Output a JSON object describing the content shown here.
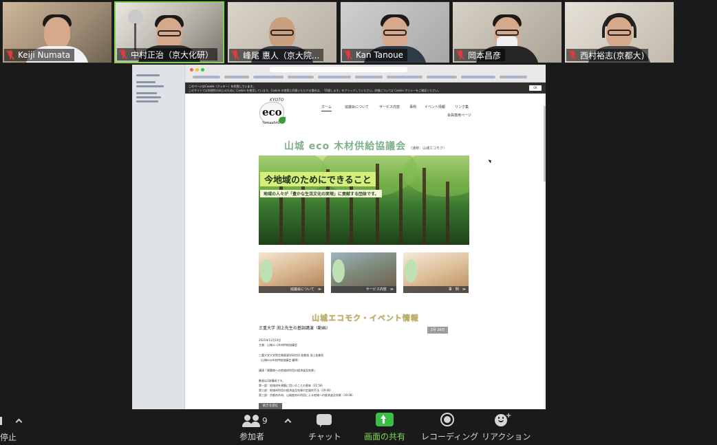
{
  "participants": [
    {
      "name": "Keiji Numata",
      "muted": true
    },
    {
      "name": "中村正治（京大化研）",
      "muted": true
    },
    {
      "name": "峰尾 惠人（京大院...",
      "muted": true
    },
    {
      "name": "Kan Tanoue",
      "muted": true
    },
    {
      "name": "岡本昌彦",
      "muted": true
    },
    {
      "name": "西村裕志(京都大)",
      "muted": true
    }
  ],
  "shared_page": {
    "cookie_notice": {
      "line1": "このページはCookie（クッキー）を利用しています。",
      "line2": "このサイトでは利便性の向上のために Cookie を使用しています。Cookie の使用に同意いただける場合は、「同意します」をクリックしてください。詳細については Cookie ポリシーをご確認ください。",
      "ok": "OK"
    },
    "logo": {
      "kyoto": "KYOTO",
      "eco": "eco",
      "sub": "Yamashiro"
    },
    "nav": {
      "items": [
        "ホーム",
        "協議会について",
        "サービス内容",
        "事例",
        "イベント情報",
        "リンク集"
      ],
      "member": "会員専用ページ"
    },
    "title": "山城 eco 木材供給協議会",
    "title_sub": "（通称：山城エコモク）",
    "hero": {
      "headline": "今地域のためにできること",
      "subline": "地域の人々が「豊かな生活文化の実現」に貢献する団体です。"
    },
    "cards": [
      {
        "label": "協議会について　≫"
      },
      {
        "label": "サービス内容　≫"
      },
      {
        "label": "事　例　≫"
      }
    ],
    "events": {
      "section_title": "山城エコモク・イベント情報",
      "headline": "三重大学 渕上先生の基調講演（動画）",
      "date_badge": "2月 28日",
      "lines": [
        "2021年11月19日",
        "主催：山城エコ木材供給協議会",
        "",
        "三重大学大学院生物資源学研究科 准教授 渕上佑樹氏",
        "（山城eco木材供給協議会 顧問）",
        "",
        "講演「建築物への地域材利用の経済波及効果」",
        "",
        "動画は3部構成です。",
        "第一部：地域材を建築に用いることの意味（21:58）",
        "第二部：地域材利用の経済波及効果の定量的手法（19:46）",
        "第三部：京都府木材、山城産材の利用による地域への経済波及効果（19:08）"
      ],
      "more_button": "続きを読む"
    }
  },
  "toolbar": {
    "stop_label": "停止",
    "participants_label": "参加者",
    "participants_count": "9",
    "chat_label": "チャット",
    "share_label": "画面の共有",
    "record_label": "レコーディング",
    "reaction_label": "リアクション"
  },
  "colors": {
    "share_accent": "#7ed957",
    "muted_red": "#e0393e",
    "active_speaker": "#7fd14f"
  }
}
